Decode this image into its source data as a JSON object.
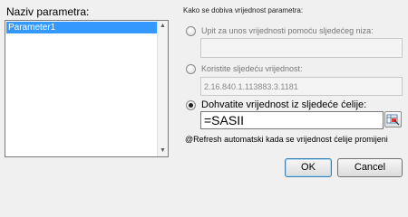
{
  "parameters": {
    "heading": "Naziv parametra:",
    "items": [
      "Parameter1"
    ],
    "selected_index": 0
  },
  "source_group": {
    "title": "Kako se dobiva vrijednost parametra:",
    "options": [
      {
        "label": "Upit za unos vrijednosti pomoću sljedećeg niza:",
        "value": "",
        "checked": false,
        "enabled": false
      },
      {
        "label": "Koristite sljedeću vrijednost:",
        "value": "2.16.840.1.113883.3.1181",
        "checked": false,
        "enabled": false
      },
      {
        "label": "Dohvatite vrijednost iz sljedeće ćelije:",
        "value": "=SASII",
        "checked": true,
        "enabled": true
      }
    ],
    "refresh_label": "@Refresh automatski kada se vrijednost ćelije promijeni"
  },
  "buttons": {
    "ok": "OK",
    "cancel": "Cancel"
  },
  "icons": {
    "scroll_up": "scroll-up-arrow",
    "scroll_down": "scroll-down-arrow",
    "cell_picker": "range-select-icon"
  },
  "colors": {
    "selection": "#3399ff",
    "dialog_bg": "#f0f0f0"
  }
}
